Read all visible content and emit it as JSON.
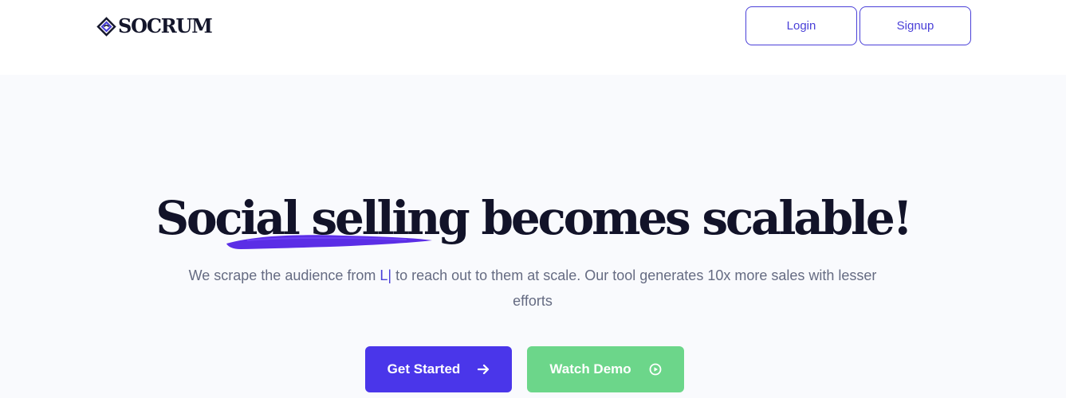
{
  "brand": {
    "name": "SOCRUM",
    "accent": "#4a40d8"
  },
  "nav": {
    "login_label": "Login",
    "signup_label": "Signup"
  },
  "hero": {
    "title": "Social selling becomes scalable!",
    "subtitle_before": "We scrape the audience from ",
    "typed_text": "L",
    "caret": "|",
    "subtitle_after": " to reach out to them at scale. Our tool generates 10x more sales with lesser efforts",
    "background": "#f9fafd"
  },
  "cta": {
    "primary_label": "Get Started",
    "primary_icon": "arrow-right-icon",
    "primary_color": "#4a36ea",
    "secondary_label": "Watch Demo",
    "secondary_icon": "play-circle-icon",
    "secondary_color": "#6cd68a"
  }
}
